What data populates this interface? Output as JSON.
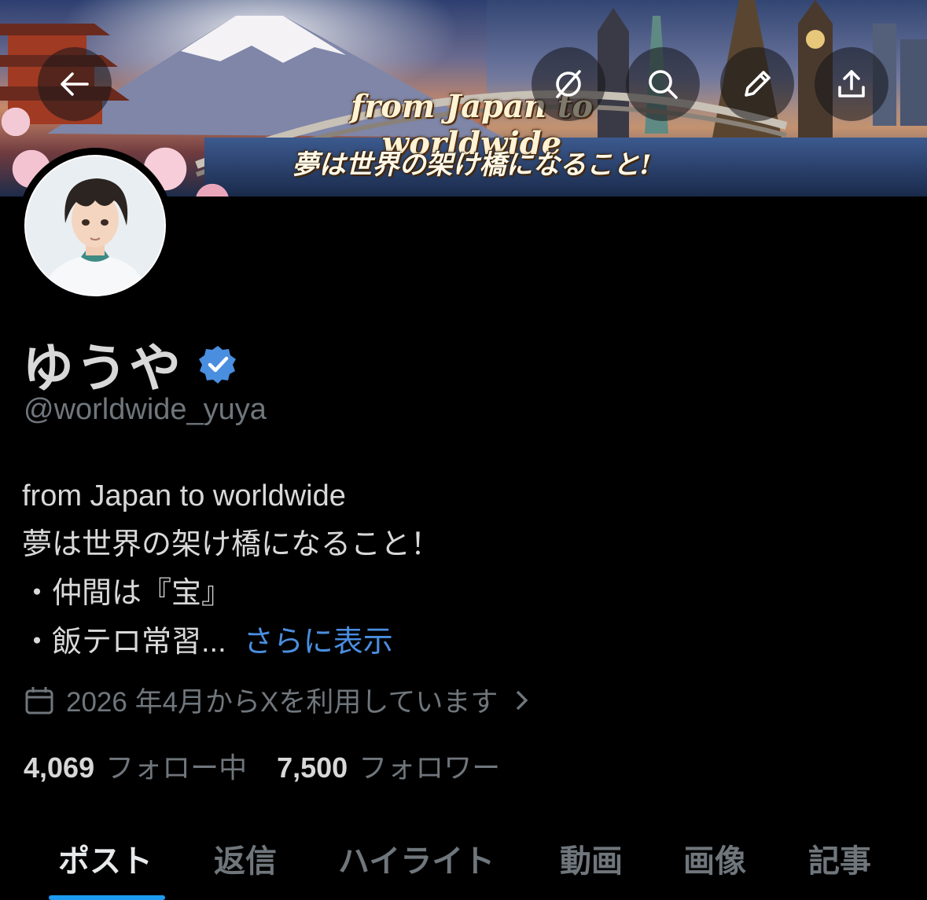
{
  "banner": {
    "title_en": "from Japan to worldwide",
    "title_jp": "夢は世界の架け橋になること!"
  },
  "header": {
    "back_icon": "back-arrow-icon",
    "grok_icon": "grok-icon",
    "search_icon": "search-icon",
    "edit_icon": "pencil-icon",
    "share_icon": "share-icon"
  },
  "profile": {
    "name": "ゆうや",
    "handle": "@worldwide_yuya",
    "verified_color": "#4a8ee0",
    "bio": {
      "line1": "from Japan to worldwide",
      "line2": "夢は世界の架け橋になること！",
      "line3": "・仲間は『宝』",
      "line4": "・飯テロ常習...",
      "more": "さらに表示"
    },
    "joined": "2026 年4月からXを利用しています",
    "following_count": "4,069",
    "following_label": "フォロー中",
    "followers_count": "7,500",
    "followers_label": "フォロワー"
  },
  "tabs": [
    {
      "label": "ポスト"
    },
    {
      "label": "返信"
    },
    {
      "label": "ハイライト"
    },
    {
      "label": "動画"
    },
    {
      "label": "画像"
    },
    {
      "label": "記事"
    }
  ],
  "colors": {
    "background": "#000000",
    "accent": "#1d9bf0",
    "link": "#4a8ee0",
    "muted": "#6f767c"
  }
}
